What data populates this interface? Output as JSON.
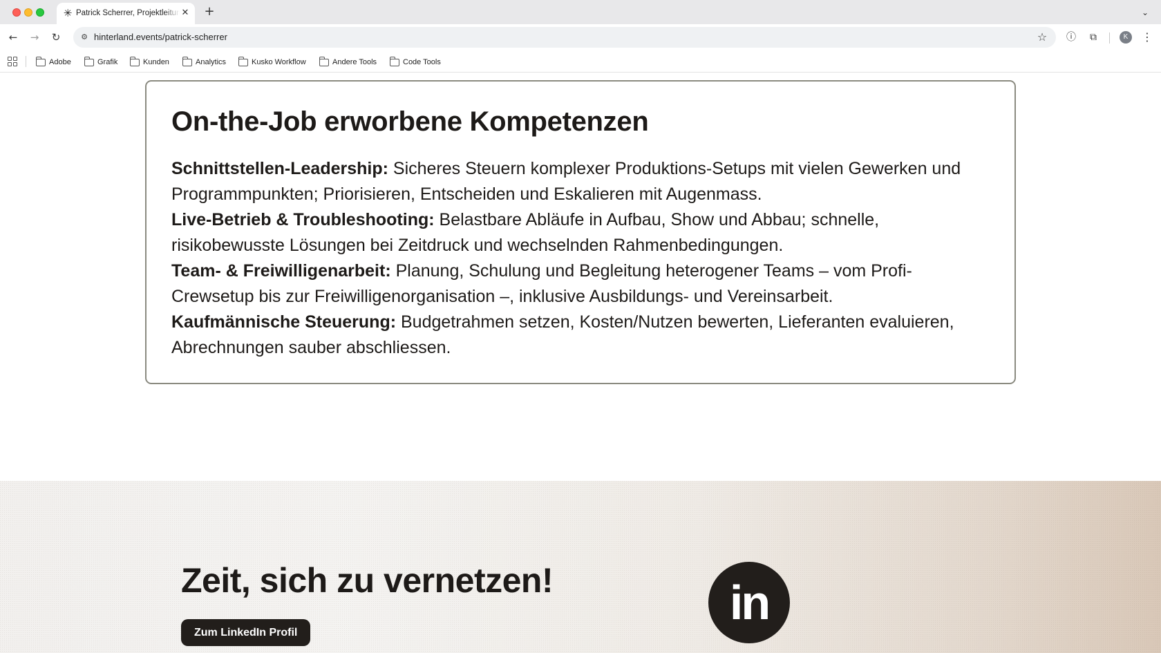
{
  "browser": {
    "tab_favicon": "✳",
    "tab_title": "Patrick Scherrer, Projektleitung",
    "tab_close": "✕",
    "new_tab": "+",
    "tab_menu": "⌄",
    "url": "hinterland.events/patrick-scherrer",
    "profile_initial": "K",
    "icons": {
      "back": "back-arrow-icon",
      "forward": "forward-arrow-icon",
      "reload": "reload-icon",
      "site_info": "site-settings-icon",
      "bookmark": "star-icon",
      "password_manager": "onepassword-icon",
      "extensions": "puzzle-icon",
      "menu": "kebab-menu-icon"
    }
  },
  "bookmarks": [
    {
      "label": "Adobe"
    },
    {
      "label": "Grafik"
    },
    {
      "label": "Kunden"
    },
    {
      "label": "Analytics"
    },
    {
      "label": "Kusko Workflow"
    },
    {
      "label": "Andere Tools"
    },
    {
      "label": "Code Tools"
    }
  ],
  "competences": {
    "title": "On-the-Job erworbene Kompetenzen",
    "items": [
      {
        "term": "Schnittstellen-Leadership:",
        "text": " Sicheres Steuern komplexer Produktions-Setups mit vielen Gewerken und Programmpunkten; Priorisieren, Entscheiden und Eskalieren mit Augenmass."
      },
      {
        "term": "Live-Betrieb & Troubleshooting:",
        "text": " Belastbare Abläufe in Aufbau, Show und Abbau; schnelle, risikobewusste Lösungen bei Zeitdruck und wechselnden Rahmenbedingungen."
      },
      {
        "term": "Team- & Freiwilligenarbeit:",
        "text": " Planung, Schulung und Begleitung heterogener Teams – vom Profi-Crewsetup bis zur Freiwilligenorganisation –, inklusive Ausbildungs- und Vereinsarbeit."
      },
      {
        "term": "Kaufmännische Steuerung:",
        "text": " Budgetrahmen setzen, Kosten/Nutzen bewerten, Lieferanten evaluieren, Abrechnungen sauber abschliessen."
      }
    ]
  },
  "connect": {
    "title": "Zeit, sich zu vernetzen!",
    "button_label": "Zum LinkedIn Profil",
    "logo_text": "in",
    "colors": {
      "dark": "#221e1b",
      "card_border": "#8a8a80"
    }
  }
}
